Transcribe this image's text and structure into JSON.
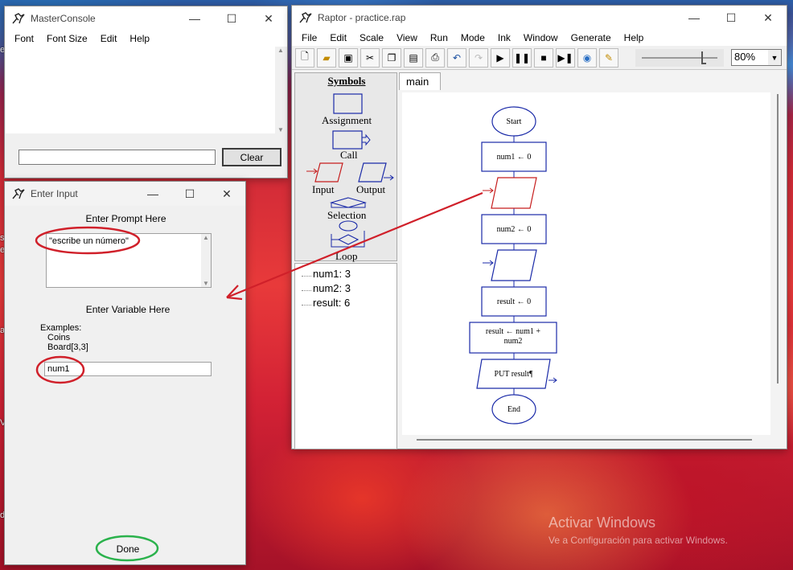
{
  "desktop": {
    "watermark_title": "Activar Windows",
    "watermark_sub": "Ve a Configuración para activar Windows."
  },
  "master_console": {
    "title": "MasterConsole",
    "menu": [
      "Font",
      "Font Size",
      "Edit",
      "Help"
    ],
    "input_value": "",
    "clear_label": "Clear"
  },
  "enter_input": {
    "title": "Enter Input",
    "prompt_label": "Enter Prompt Here",
    "prompt_value": "\"escribe un número\"",
    "variable_label": "Enter Variable Here",
    "examples_label": "Examples:",
    "examples": [
      "Coins",
      "Board[3,3]"
    ],
    "variable_value": "num1",
    "done_label": "Done"
  },
  "raptor": {
    "title": "Raptor - practice.rap",
    "menu": [
      "File",
      "Edit",
      "Scale",
      "View",
      "Run",
      "Mode",
      "Ink",
      "Window",
      "Generate",
      "Help"
    ],
    "zoom": "80%",
    "symbols_title": "Symbols",
    "symbols": [
      "Assignment",
      "Call",
      "Input",
      "Output",
      "Selection",
      "Loop"
    ],
    "watch": [
      "num1: 3",
      "num2: 3",
      "result: 6"
    ],
    "tab": "main",
    "flowchart": {
      "start": "Start",
      "a1": "num1 ← 0",
      "a2": "num2 ← 0",
      "a3": "result ← 0",
      "a4_line1": "result ← num1 +",
      "a4_line2": "num2",
      "output": "PUT result¶",
      "end": "End"
    }
  },
  "annotation_colors": {
    "red": "#d0202a",
    "green": "#2bb24c"
  }
}
